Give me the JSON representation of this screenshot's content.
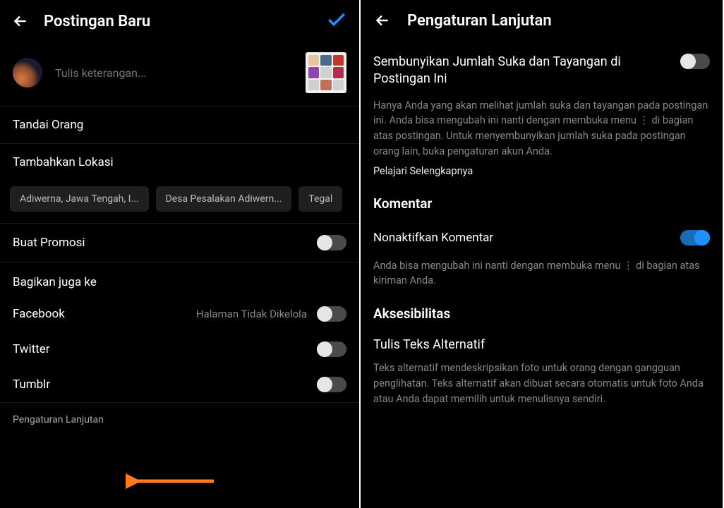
{
  "left": {
    "title": "Postingan Baru",
    "caption_placeholder": "Tulis keterangan...",
    "tag_people": "Tandai Orang",
    "add_location": "Tambahkan Lokasi",
    "locations": [
      "Adiwerna, Jawa Tengah, I...",
      "Desa Pesalakan Adiwern...",
      "Tegal"
    ],
    "promote": "Buat Promosi",
    "share_to": "Bagikan juga ke",
    "shares": [
      {
        "name": "Facebook",
        "sub": "Halaman Tidak Dikelola",
        "on": false
      },
      {
        "name": "Twitter",
        "sub": "",
        "on": false
      },
      {
        "name": "Tumblr",
        "sub": "",
        "on": false
      }
    ],
    "advanced": "Pengaturan Lanjutan"
  },
  "right": {
    "title": "Pengaturan Lanjutan",
    "hide_likes_title": "Sembunyikan Jumlah Suka dan Tayangan di Postingan Ini",
    "hide_likes_desc": "Hanya Anda yang akan melihat jumlah suka dan tayangan pada postingan ini. Anda bisa mengubah ini nanti dengan membuka menu ⋮ di bagian atas postingan. Untuk menyembunyikan jumlah suka pada postingan orang lain, buka pengaturan akun Anda.",
    "learn_more": "Pelajari Selengkapnya",
    "comments_section": "Komentar",
    "disable_comments": "Nonaktifkan Komentar",
    "disable_comments_desc": "Anda bisa mengubah ini nanti dengan membuka menu ⋮ di bagian atas kiriman Anda.",
    "accessibility_section": "Aksesibilitas",
    "alt_text_title": "Tulis Teks Alternatif",
    "alt_text_desc": "Teks alternatif mendeskripsikan foto untuk orang dengan gangguan penglihatan. Teks alternatif akan dibuat secara otomatis untuk foto Anda atau Anda dapat memilih untuk menulisnya sendiri."
  },
  "colors": {
    "accent": "#1e90ff",
    "arrow": "#ff7a1a"
  }
}
